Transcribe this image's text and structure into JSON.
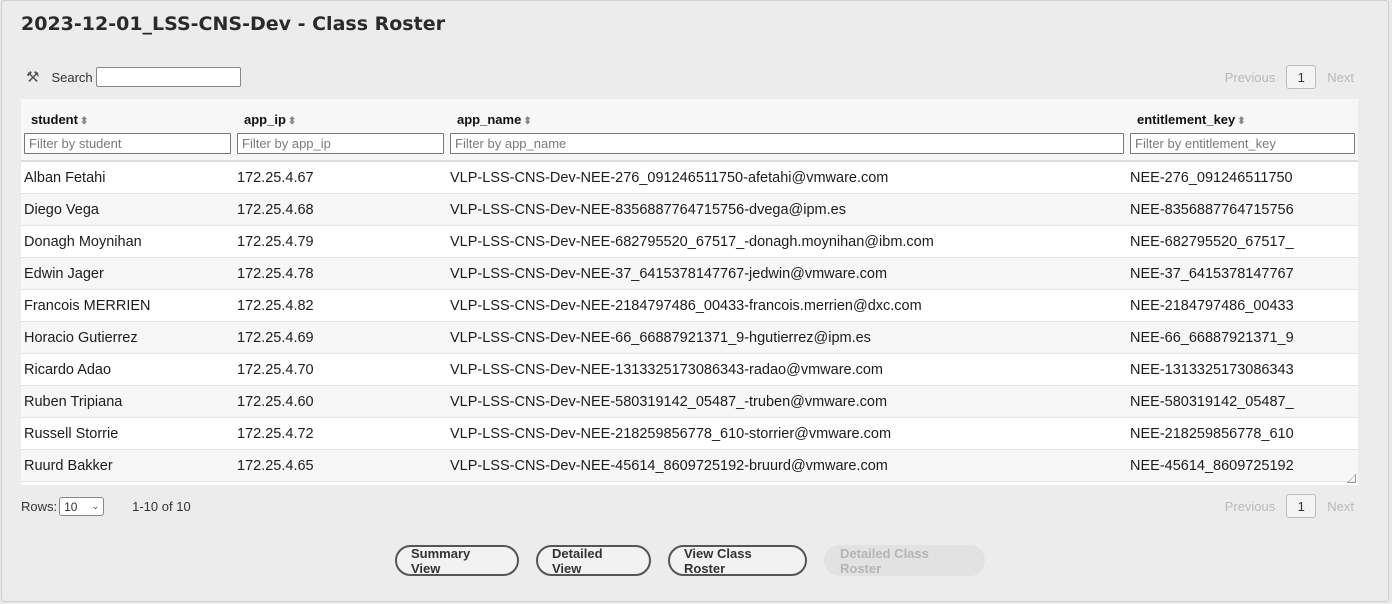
{
  "title": "2023-12-01_LSS-CNS-Dev - Class Roster",
  "search": {
    "label": "Search",
    "value": ""
  },
  "pagination": {
    "previous": "Previous",
    "page": "1",
    "next": "Next"
  },
  "columns": [
    {
      "header": "student",
      "filter_placeholder": "Filter by student"
    },
    {
      "header": "app_ip",
      "filter_placeholder": "Filter by app_ip"
    },
    {
      "header": "app_name",
      "filter_placeholder": "Filter by app_name"
    },
    {
      "header": "entitlement_key",
      "filter_placeholder": "Filter by entitlement_key"
    }
  ],
  "rows": [
    [
      "Alban Fetahi",
      "172.25.4.67",
      "VLP-LSS-CNS-Dev-NEE-276_091246511750-afetahi@vmware.com",
      "NEE-276_091246511750"
    ],
    [
      "Diego Vega",
      "172.25.4.68",
      "VLP-LSS-CNS-Dev-NEE-8356887764715756-dvega@ipm.es",
      "NEE-8356887764715756"
    ],
    [
      "Donagh Moynihan",
      "172.25.4.79",
      "VLP-LSS-CNS-Dev-NEE-682795520_67517_-donagh.moynihan@ibm.com",
      "NEE-682795520_67517_"
    ],
    [
      "Edwin Jager",
      "172.25.4.78",
      "VLP-LSS-CNS-Dev-NEE-37_6415378147767-jedwin@vmware.com",
      "NEE-37_6415378147767"
    ],
    [
      "Francois MERRIEN",
      "172.25.4.82",
      "VLP-LSS-CNS-Dev-NEE-2184797486_00433-francois.merrien@dxc.com",
      "NEE-2184797486_00433"
    ],
    [
      "Horacio Gutierrez",
      "172.25.4.69",
      "VLP-LSS-CNS-Dev-NEE-66_66887921371_9-hgutierrez@ipm.es",
      "NEE-66_66887921371_9"
    ],
    [
      "Ricardo Adao",
      "172.25.4.70",
      "VLP-LSS-CNS-Dev-NEE-1313325173086343-radao@vmware.com",
      "NEE-1313325173086343"
    ],
    [
      "Ruben Tripiana",
      "172.25.4.60",
      "VLP-LSS-CNS-Dev-NEE-580319142_05487_-truben@vmware.com",
      "NEE-580319142_05487_"
    ],
    [
      "Russell Storrie",
      "172.25.4.72",
      "VLP-LSS-CNS-Dev-NEE-218259856778_610-storrier@vmware.com",
      "NEE-218259856778_610"
    ],
    [
      "Ruurd Bakker",
      "172.25.4.65",
      "VLP-LSS-CNS-Dev-NEE-45614_8609725192-bruurd@vmware.com",
      "NEE-45614_8609725192"
    ]
  ],
  "footer": {
    "rows_label": "Rows:",
    "rows_value": "10",
    "range": "1-10 of 10"
  },
  "buttons": {
    "summary": "Summary View",
    "detailed": "Detailed View",
    "class_roster": "View Class Roster",
    "detailed_class_roster": "Detailed Class Roster"
  }
}
